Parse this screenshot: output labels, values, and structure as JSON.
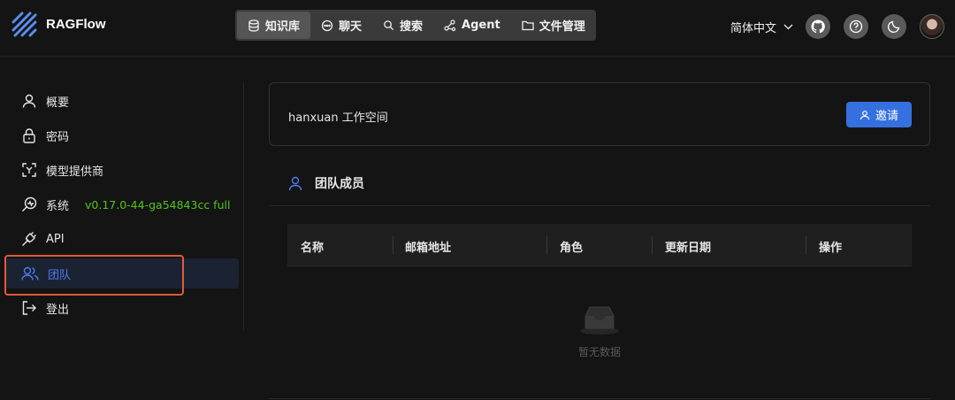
{
  "app": {
    "name": "RAGFlow"
  },
  "topnav": {
    "items": [
      {
        "label": "知识库",
        "icon": "database-icon",
        "active": true
      },
      {
        "label": "聊天",
        "icon": "chat-bubble-icon",
        "active": false
      },
      {
        "label": "搜索",
        "icon": "search-icon",
        "active": false
      },
      {
        "label": "Agent",
        "icon": "agent-graph-icon",
        "active": false
      },
      {
        "label": "文件管理",
        "icon": "folder-icon",
        "active": false
      }
    ]
  },
  "header": {
    "language": "简体中文",
    "buttons": [
      "github-icon",
      "help-icon",
      "moon-icon"
    ],
    "avatar": "user-avatar"
  },
  "sidebar": {
    "items": [
      {
        "label": "概要",
        "icon": "user-icon"
      },
      {
        "label": "密码",
        "icon": "lock-icon"
      },
      {
        "label": "模型提供商",
        "icon": "model-provider-icon"
      },
      {
        "label": "系统",
        "icon": "system-monitor-icon",
        "version": "v0.17.0-44-ga54843cc full"
      },
      {
        "label": "API",
        "icon": "api-plug-icon"
      },
      {
        "label": "团队",
        "icon": "team-icon",
        "active": true
      },
      {
        "label": "登出",
        "icon": "logout-icon"
      }
    ]
  },
  "workspace": {
    "title": "hanxuan 工作空间",
    "invite_label": "邀请"
  },
  "team": {
    "title": "团队成员",
    "columns": [
      "名称",
      "邮箱地址",
      "角色",
      "更新日期",
      "操作"
    ],
    "rows": [],
    "empty_text": "暂无数据"
  },
  "colors": {
    "accent": "#3670e0",
    "active_text": "#4d7cf0",
    "version_text": "#52c41a",
    "highlight_border": "#e05a3a"
  }
}
